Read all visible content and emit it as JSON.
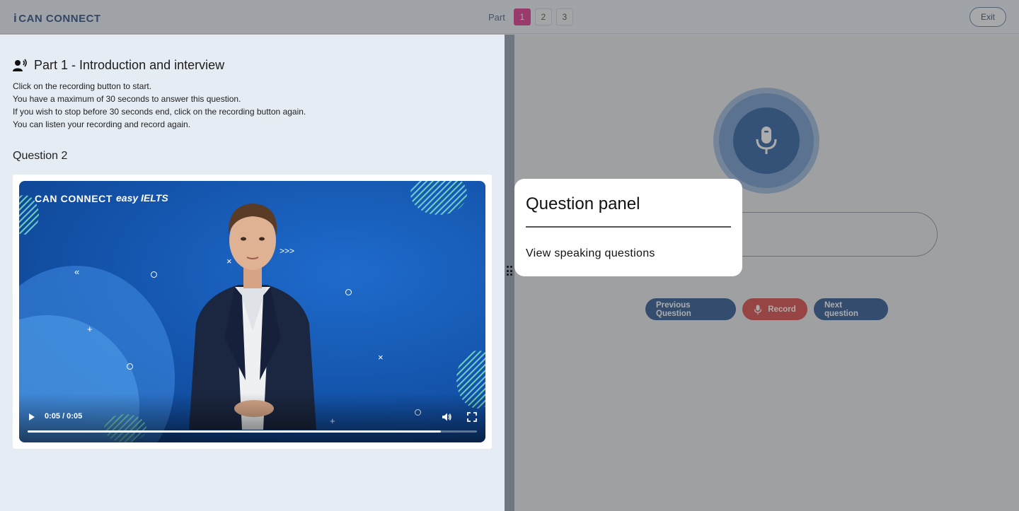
{
  "header": {
    "logo": "CAN CONNECT",
    "part_label": "Part",
    "parts": [
      "1",
      "2",
      "3"
    ],
    "active_part": "1",
    "exit_label": "Exit"
  },
  "left": {
    "part_title": "Part 1 - Introduction and interview",
    "instructions": [
      "Click on the recording button to start.",
      "You have a maximum of 30 seconds to answer this question.",
      "If you wish to stop before 30 seconds end, click on the recording button again.",
      "You can listen your recording and record again."
    ],
    "question_title": "Question 2",
    "video": {
      "brand_logo": "CAN CONNECT",
      "brand_logo2": "easy IELTS",
      "time": "0:05 / 0:05",
      "progress_fraction": 0.92
    }
  },
  "right": {
    "buttons": {
      "previous": "Previous Question",
      "record": "Record",
      "next": "Next question"
    }
  },
  "popup": {
    "title": "Question panel",
    "link": "View speaking questions"
  },
  "colors": {
    "accent_active_part": "#d81b7f",
    "primary_button": "#0e3f80",
    "record_button": "#d32f2f"
  }
}
